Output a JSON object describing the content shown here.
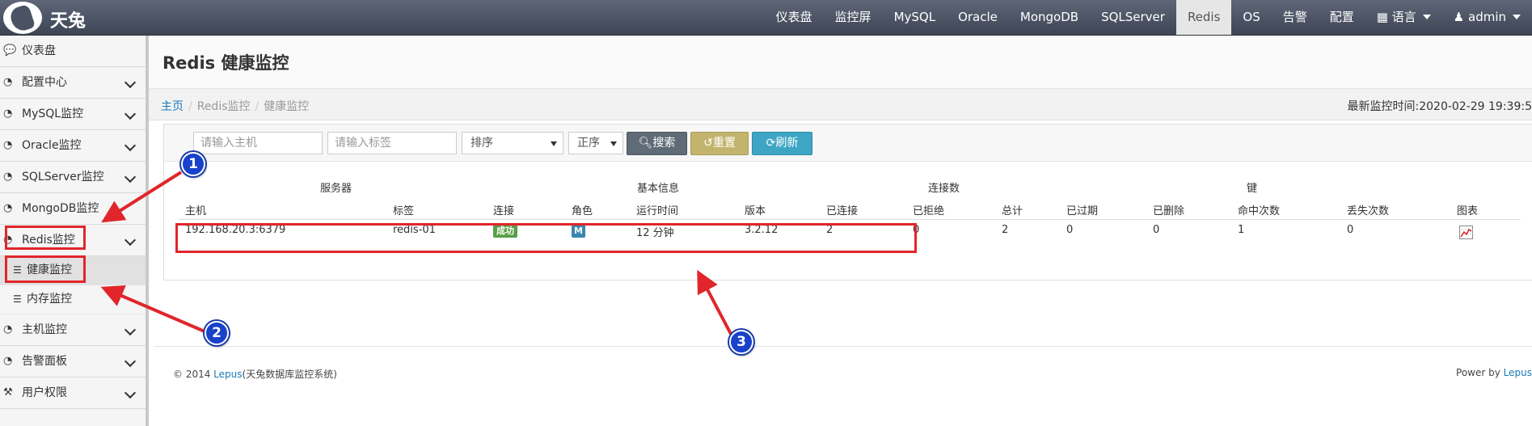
{
  "navbar": {
    "brand": "天兔",
    "items": [
      {
        "label": "仪表盘"
      },
      {
        "label": "监控屏"
      },
      {
        "label": "MySQL"
      },
      {
        "label": "Oracle"
      },
      {
        "label": "MongoDB"
      },
      {
        "label": "SQLServer"
      },
      {
        "label": "Redis",
        "active": true
      },
      {
        "label": "OS"
      },
      {
        "label": "告警"
      },
      {
        "label": "配置"
      }
    ],
    "language": "语言",
    "user": "admin"
  },
  "sidebar": {
    "items": [
      {
        "label": "仪表盘",
        "icon": "comment-icon"
      },
      {
        "label": "配置中心",
        "icon": "dashboard-icon"
      },
      {
        "label": "MySQL监控",
        "icon": "dashboard-icon"
      },
      {
        "label": "Oracle监控",
        "icon": "dashboard-icon"
      },
      {
        "label": "SQLServer监控",
        "icon": "dashboard-icon"
      },
      {
        "label": "MongoDB监控",
        "icon": "dashboard-icon"
      },
      {
        "label": "Redis监控",
        "icon": "dashboard-icon"
      },
      {
        "label": "主机监控",
        "icon": "dashboard-icon"
      },
      {
        "label": "告警面板",
        "icon": "dashboard-icon"
      },
      {
        "label": "用户权限",
        "icon": "hammer-icon"
      }
    ],
    "redis_sub": [
      {
        "label": "健康监控",
        "active": true,
        "icon": "list-icon"
      },
      {
        "label": "内存监控",
        "icon": "list-icon"
      }
    ]
  },
  "page": {
    "title": "Redis 健康监控",
    "breadcrumb": {
      "home": "主页",
      "parent": "Redis监控",
      "current": "健康监控"
    },
    "monitor_time": "最新监控时间:2020-02-29 19:39:5"
  },
  "filters": {
    "host_placeholder": "请输入主机",
    "tag_placeholder": "请输入标签",
    "sort_value": "排序",
    "order_value": "正序",
    "search_label": "搜索",
    "reset_label": "重置",
    "refresh_label": "刷新"
  },
  "table": {
    "groups": [
      "服务器",
      "基本信息",
      "连接数",
      "键"
    ],
    "columns": [
      "主机",
      "标签",
      "连接",
      "角色",
      "运行时间",
      "版本",
      "已连接",
      "已拒绝",
      "总计",
      "已过期",
      "已删除",
      "命中次数",
      "丢失次数",
      "图表"
    ],
    "rows": [
      {
        "host": "192.168.20.3:6379",
        "tag": "redis-01",
        "connect": "成功",
        "role": "M",
        "uptime": "12 分钟",
        "version": "3.2.12",
        "connected": "2",
        "rejected": "0",
        "total": "2",
        "expired": "0",
        "deleted": "0",
        "hits": "1",
        "misses": "0",
        "chart_icon": "chart-icon"
      }
    ]
  },
  "footer": {
    "copyright_prefix": "© 2014 ",
    "copyright_link": "Lepus",
    "copyright_suffix": "(天兔数据库监控系统)",
    "powered_prefix": "Power by ",
    "powered_link": "Lepus"
  },
  "annotations": {
    "markers": [
      "1",
      "2",
      "3"
    ],
    "color": "#e0262b",
    "marker_color": "#1742c9"
  }
}
